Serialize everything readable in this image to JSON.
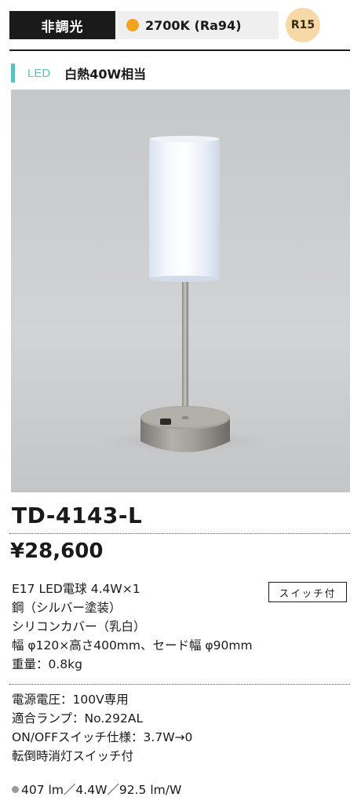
{
  "header": {
    "dimming_label": "非調光",
    "color_temp": "2700K (Ra94)",
    "color_dot_color": "#f5a21f",
    "rank_badge": "R15"
  },
  "light_source": {
    "type_label": "LED",
    "equivalent": "白熱40W相当",
    "accent_color": "#5bbfc4"
  },
  "product": {
    "model": "TD-4143-L",
    "price": "¥28,600",
    "switch_tag": "スイッチ付"
  },
  "specs": [
    "E17 LED電球 4.4W×1",
    "鋼（シルバー塗装）",
    "シリコンカバー（乳白）",
    "幅 φ120×高さ400mm、セード幅 φ90mm",
    "重量：0.8kg"
  ],
  "electrical": [
    "電源電圧：100V専用",
    "適合ランプ：No.292AL",
    "ON/OFFスイッチ仕様：3.7W→0",
    "転倒時消灯スイッチ付"
  ],
  "efficiency": "407 lm／4.4W／92.5 lm/W"
}
